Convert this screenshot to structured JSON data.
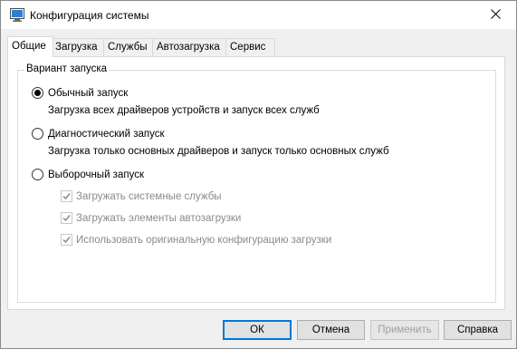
{
  "window": {
    "title": "Конфигурация системы"
  },
  "tabs": [
    {
      "label": "Общие",
      "active": true
    },
    {
      "label": "Загрузка",
      "active": false
    },
    {
      "label": "Службы",
      "active": false
    },
    {
      "label": "Автозагрузка",
      "active": false
    },
    {
      "label": "Сервис",
      "active": false
    }
  ],
  "group": {
    "title": "Вариант запуска",
    "options": [
      {
        "label": "Обычный запуск",
        "description": "Загрузка всех драйверов устройств и запуск всех служб",
        "selected": true
      },
      {
        "label": "Диагностический запуск",
        "description": "Загрузка только основных драйверов и запуск только основных служб",
        "selected": false
      },
      {
        "label": "Выборочный запуск",
        "description": "",
        "selected": false
      }
    ],
    "checkboxes": [
      {
        "label": "Загружать системные службы",
        "checked": true,
        "enabled": false
      },
      {
        "label": "Загружать элементы автозагрузки",
        "checked": true,
        "enabled": false
      },
      {
        "label": "Использовать оригинальную конфигурацию загрузки",
        "checked": true,
        "enabled": false
      }
    ]
  },
  "buttons": {
    "ok": "ОК",
    "cancel": "Отмена",
    "apply": "Применить",
    "help": "Справка"
  },
  "colors": {
    "accent": "#0078d7",
    "disabled_text": "#8a8a8a"
  }
}
